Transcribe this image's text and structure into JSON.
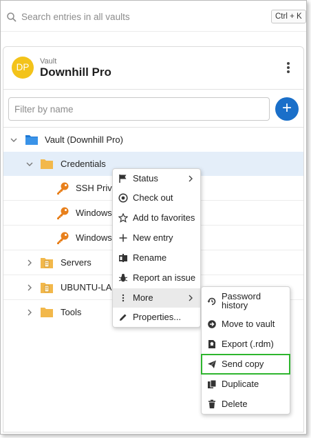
{
  "search": {
    "placeholder": "Search entries in all vaults",
    "shortcut": "Ctrl + K"
  },
  "vault": {
    "avatar_initials": "DP",
    "avatar_color": "#f3c31a",
    "subtitle": "Vault",
    "name": "Downhill Pro"
  },
  "filter": {
    "placeholder": "Filter by name"
  },
  "add_button": {
    "label": "+",
    "color": "#1a6fc9"
  },
  "tree": {
    "root": {
      "label": "Vault (Downhill Pro)",
      "icon": "vault-folder-icon"
    },
    "items": [
      {
        "label": "Credentials",
        "icon": "folder-icon",
        "expanded": true,
        "selected": true
      },
      {
        "label": "SSH Privile",
        "icon": "key-icon"
      },
      {
        "label": "Windows A",
        "icon": "key-icon"
      },
      {
        "label": "Windows L",
        "icon": "key-icon"
      },
      {
        "label": "Servers",
        "icon": "server-folder-icon",
        "expanded": false
      },
      {
        "label": "UBUNTU-LAM",
        "icon": "server-folder-icon",
        "expanded": false
      },
      {
        "label": "Tools",
        "icon": "folder-icon",
        "expanded": false
      }
    ]
  },
  "context_menu": {
    "items": [
      {
        "label": "Status",
        "icon": "flag-icon",
        "has_submenu": true
      },
      {
        "label": "Check out",
        "icon": "checkout-icon"
      },
      {
        "label": "Add to favorites",
        "icon": "star-icon"
      },
      {
        "label": "New entry",
        "icon": "plus-icon"
      },
      {
        "label": "Rename",
        "icon": "rename-icon"
      },
      {
        "label": "Report an issue",
        "icon": "bug-icon"
      },
      {
        "label": "More",
        "icon": "more-icon",
        "has_submenu": true,
        "active": true
      },
      {
        "label": "Properties...",
        "icon": "pencil-icon"
      }
    ]
  },
  "more_submenu": {
    "items": [
      {
        "label": "Password history",
        "label_line1": "Password",
        "label_line2": "history",
        "icon": "history-icon"
      },
      {
        "label": "Move to vault",
        "icon": "move-icon"
      },
      {
        "label": "Export (.rdm)",
        "icon": "export-icon"
      },
      {
        "label": "Send copy",
        "icon": "send-icon",
        "highlighted": true
      },
      {
        "label": "Duplicate",
        "icon": "duplicate-icon"
      },
      {
        "label": "Delete",
        "icon": "trash-icon"
      }
    ]
  },
  "colors": {
    "highlight": "#2db52d",
    "selection": "#e4eef9",
    "folder": "#f2b84b",
    "key": "#e8801c",
    "vault_blue": "#1e78d4"
  }
}
